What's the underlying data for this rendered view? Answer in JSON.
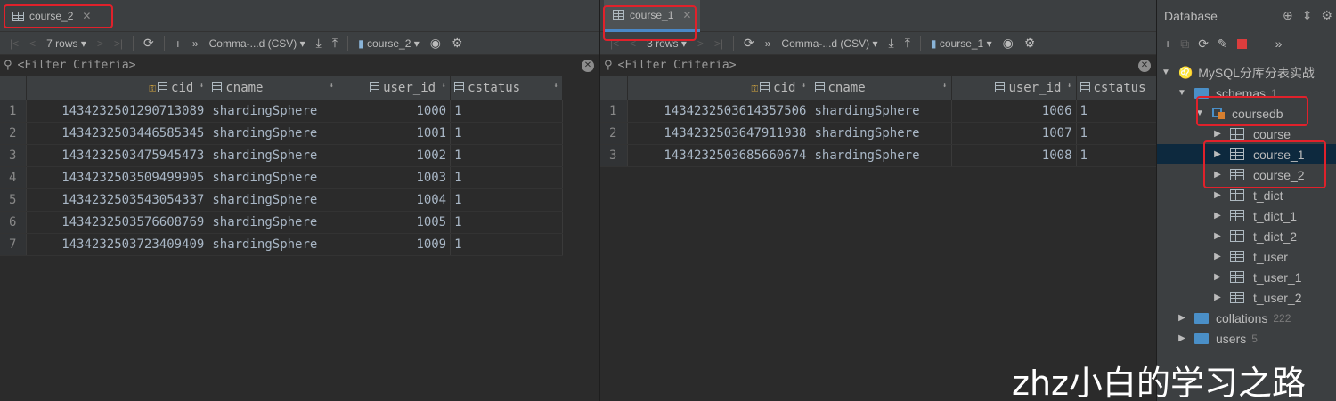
{
  "left": {
    "tab_label": "course_2",
    "toolbar": {
      "rows_label": "7 rows",
      "export_format": "Comma-...d (CSV)",
      "table_selector": "course_2"
    },
    "filter_placeholder": "<Filter Criteria>",
    "columns": [
      "cid",
      "cname",
      "user_id",
      "cstatus"
    ],
    "rows": [
      {
        "rn": "1",
        "cid": "1434232501290713089",
        "cname": "shardingSphere",
        "user_id": "1000",
        "cstatus": "1"
      },
      {
        "rn": "2",
        "cid": "1434232503446585345",
        "cname": "shardingSphere",
        "user_id": "1001",
        "cstatus": "1"
      },
      {
        "rn": "3",
        "cid": "1434232503475945473",
        "cname": "shardingSphere",
        "user_id": "1002",
        "cstatus": "1"
      },
      {
        "rn": "4",
        "cid": "1434232503509499905",
        "cname": "shardingSphere",
        "user_id": "1003",
        "cstatus": "1"
      },
      {
        "rn": "5",
        "cid": "1434232503543054337",
        "cname": "shardingSphere",
        "user_id": "1004",
        "cstatus": "1"
      },
      {
        "rn": "6",
        "cid": "1434232503576608769",
        "cname": "shardingSphere",
        "user_id": "1005",
        "cstatus": "1"
      },
      {
        "rn": "7",
        "cid": "1434232503723409409",
        "cname": "shardingSphere",
        "user_id": "1009",
        "cstatus": "1"
      }
    ]
  },
  "right": {
    "tab_label": "course_1",
    "toolbar": {
      "rows_label": "3 rows",
      "export_format": "Comma-...d (CSV)",
      "table_selector": "course_1"
    },
    "filter_placeholder": "<Filter Criteria>",
    "columns": [
      "cid",
      "cname",
      "user_id",
      "cstatus"
    ],
    "rows": [
      {
        "rn": "1",
        "cid": "1434232503614357506",
        "cname": "shardingSphere",
        "user_id": "1006",
        "cstatus": "1"
      },
      {
        "rn": "2",
        "cid": "1434232503647911938",
        "cname": "shardingSphere",
        "user_id": "1007",
        "cstatus": "1"
      },
      {
        "rn": "3",
        "cid": "1434232503685660674",
        "cname": "shardingSphere",
        "user_id": "1008",
        "cstatus": "1"
      }
    ]
  },
  "database": {
    "title": "Database",
    "connection": "MySQL分库分表实战",
    "schemas_label": "schemas",
    "schemas_count": "1",
    "schema_name": "coursedb",
    "tables": [
      "course",
      "course_1",
      "course_2",
      "t_dict",
      "t_dict_1",
      "t_dict_2",
      "t_user",
      "t_user_1",
      "t_user_2"
    ],
    "collations_label": "collations",
    "collations_count": "222",
    "users_label": "users",
    "users_count": "5"
  },
  "watermark": "zhz小白的学习之路",
  "colors": {
    "highlight_box": "#e0212b",
    "active_tab_underline": "#4a88c7",
    "folder": "#4a8fc7"
  }
}
